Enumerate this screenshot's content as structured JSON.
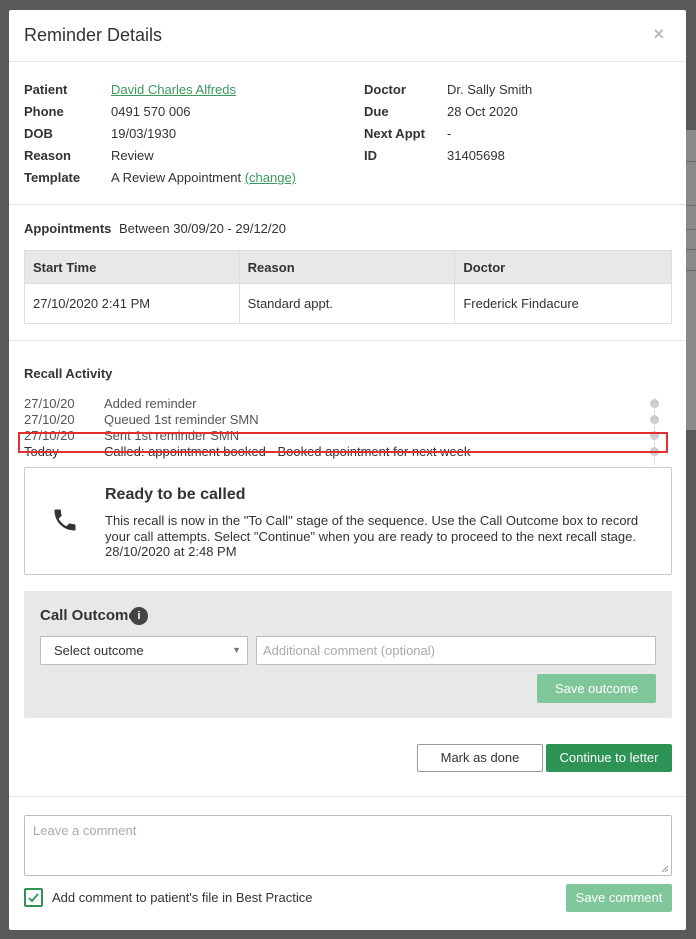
{
  "modal": {
    "title": "Reminder Details",
    "close_symbol": "×"
  },
  "details": {
    "left": [
      {
        "label": "Patient",
        "value": "David Charles Alfreds"
      },
      {
        "label": "Phone",
        "value": "0491 570 006"
      },
      {
        "label": "DOB",
        "value": "19/03/1930"
      },
      {
        "label": "Reason",
        "value": "Review"
      },
      {
        "label": "Template",
        "value": "A Review Appointment",
        "link": "(change)"
      }
    ],
    "right": [
      {
        "label": "Doctor",
        "value": "Dr. Sally Smith"
      },
      {
        "label": "Due",
        "value": "28 Oct 2020"
      },
      {
        "label": "Next Appt",
        "value": "-"
      },
      {
        "label": "ID",
        "value": "31405698"
      }
    ]
  },
  "appointments": {
    "label": "Appointments",
    "range": "Between 30/09/20 - 29/12/20",
    "columns": [
      "Start Time",
      "Reason",
      "Doctor"
    ],
    "rows": [
      [
        "27/10/2020 2:41 PM",
        "Standard appt.",
        "Frederick Findacure"
      ]
    ]
  },
  "recall": {
    "title": "Recall Activity",
    "items": [
      {
        "date": "27/10/20",
        "text": "Added reminder"
      },
      {
        "date": "27/10/20",
        "text": "Queued 1st reminder SMN"
      },
      {
        "date": "27/10/20",
        "text": "Sent 1st reminder SMN"
      },
      {
        "date": "Today",
        "text": "Called: appointment booked - Booked apointment for next week"
      }
    ],
    "card": {
      "icon": "phone-icon",
      "title": "Ready to be called",
      "text": "This recall is now in the \"To Call\" stage of the sequence. Use the Call Outcome box to record your call attempts. Select \"Continue\" when you are ready to proceed to the next recall stage.",
      "time": "28/10/2020 at 2:48 PM"
    }
  },
  "outcome": {
    "title": "Call Outcome",
    "info_symbol": "i",
    "select_value": "Select outcome",
    "comment_placeholder": "Additional comment (optional)",
    "save_label": "Save outcome"
  },
  "actions": {
    "mark_done": "Mark as done",
    "continue": "Continue to letter"
  },
  "footer": {
    "comment_placeholder": "Leave a comment",
    "checkbox_label": "Add comment to patient's file in Best Practice",
    "checkbox_checked": true,
    "save_label": "Save comment"
  },
  "colors": {
    "accent": "#2e9455",
    "accent_light": "#7fc79a",
    "link": "#3a9a5a",
    "highlight": "#e03030"
  }
}
